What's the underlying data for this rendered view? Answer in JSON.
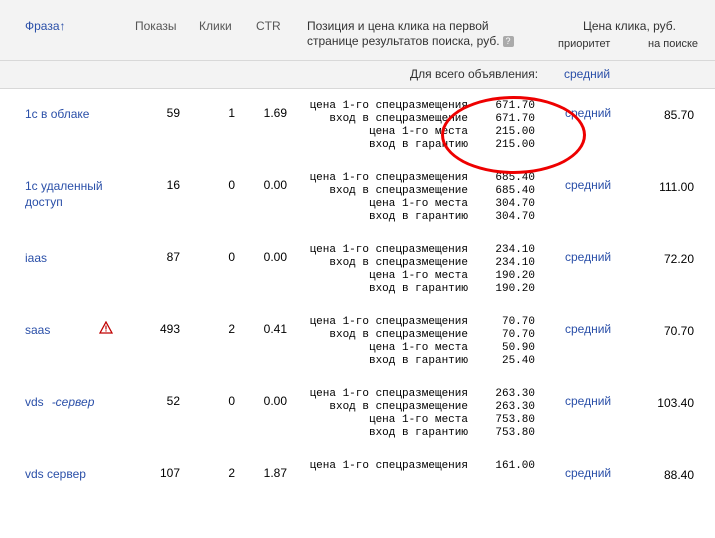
{
  "header": {
    "phrase": "Фраза",
    "sort_arrow": "↑",
    "shows": "Показы",
    "clicks": "Клики",
    "ctr": "CTR",
    "position": "Позиция и цена клика на первой странице результатов поиска, руб.",
    "help": "?",
    "click_price": "Цена клика, руб.",
    "priority": "приоритет",
    "on_search": "на поиске"
  },
  "whole_ad": {
    "label": "Для всего объявления:",
    "value": "средний"
  },
  "rows": [
    {
      "phrase": "1с в облаке",
      "shows": "59",
      "clicks": "1",
      "ctr": "1.69",
      "prices": [
        {
          "label": "цена 1-го спецразмещения",
          "value": "671.70"
        },
        {
          "label": "вход в спецразмещение",
          "value": "671.70"
        },
        {
          "label": "цена 1-го места",
          "value": "215.00"
        },
        {
          "label": "вход в гарантию",
          "value": "215.00"
        }
      ],
      "priority": "средний",
      "search_price": "85.70"
    },
    {
      "phrase": "1с удаленный доступ",
      "shows": "16",
      "clicks": "0",
      "ctr": "0.00",
      "prices": [
        {
          "label": "цена 1-го спецразмещения",
          "value": "685.40"
        },
        {
          "label": "вход в спецразмещение",
          "value": "685.40"
        },
        {
          "label": "цена 1-го места",
          "value": "304.70"
        },
        {
          "label": "вход в гарантию",
          "value": "304.70"
        }
      ],
      "priority": "средний",
      "search_price": "111.00"
    },
    {
      "phrase": "iaas",
      "shows": "87",
      "clicks": "0",
      "ctr": "0.00",
      "prices": [
        {
          "label": "цена 1-го спецразмещения",
          "value": "234.10"
        },
        {
          "label": "вход в спецразмещение",
          "value": "234.10"
        },
        {
          "label": "цена 1-го места",
          "value": "190.20"
        },
        {
          "label": "вход в гарантию",
          "value": "190.20"
        }
      ],
      "priority": "средний",
      "search_price": "72.20"
    },
    {
      "phrase": "saas",
      "shows": "493",
      "clicks": "2",
      "ctr": "0.41",
      "prices": [
        {
          "label": "цена 1-го спецразмещения",
          "value": "70.70"
        },
        {
          "label": "вход в спецразмещение",
          "value": "70.70"
        },
        {
          "label": "цена 1-го места",
          "value": "50.90"
        },
        {
          "label": "вход в гарантию",
          "value": "25.40"
        }
      ],
      "priority": "средний",
      "search_price": "70.70"
    },
    {
      "phrase": "vds",
      "phrase_neg": "-сервер",
      "shows": "52",
      "clicks": "0",
      "ctr": "0.00",
      "prices": [
        {
          "label": "цена 1-го спецразмещения",
          "value": "263.30"
        },
        {
          "label": "вход в спецразмещение",
          "value": "263.30"
        },
        {
          "label": "цена 1-го места",
          "value": "753.80"
        },
        {
          "label": "вход в гарантию",
          "value": "753.80"
        }
      ],
      "priority": "средний",
      "search_price": "103.40"
    },
    {
      "phrase": "vds сервер",
      "shows": "107",
      "clicks": "2",
      "ctr": "1.87",
      "prices": [
        {
          "label": "цена 1-го спецразмещения",
          "value": "161.00"
        }
      ],
      "priority": "средний",
      "search_price": "88.40"
    }
  ],
  "colors": {
    "link": "#2a4fa8",
    "header_bg": "#f3f3f3",
    "annotation": "#e00000",
    "warning": "#c00000"
  },
  "icons": {
    "warning": "warning-icon"
  }
}
